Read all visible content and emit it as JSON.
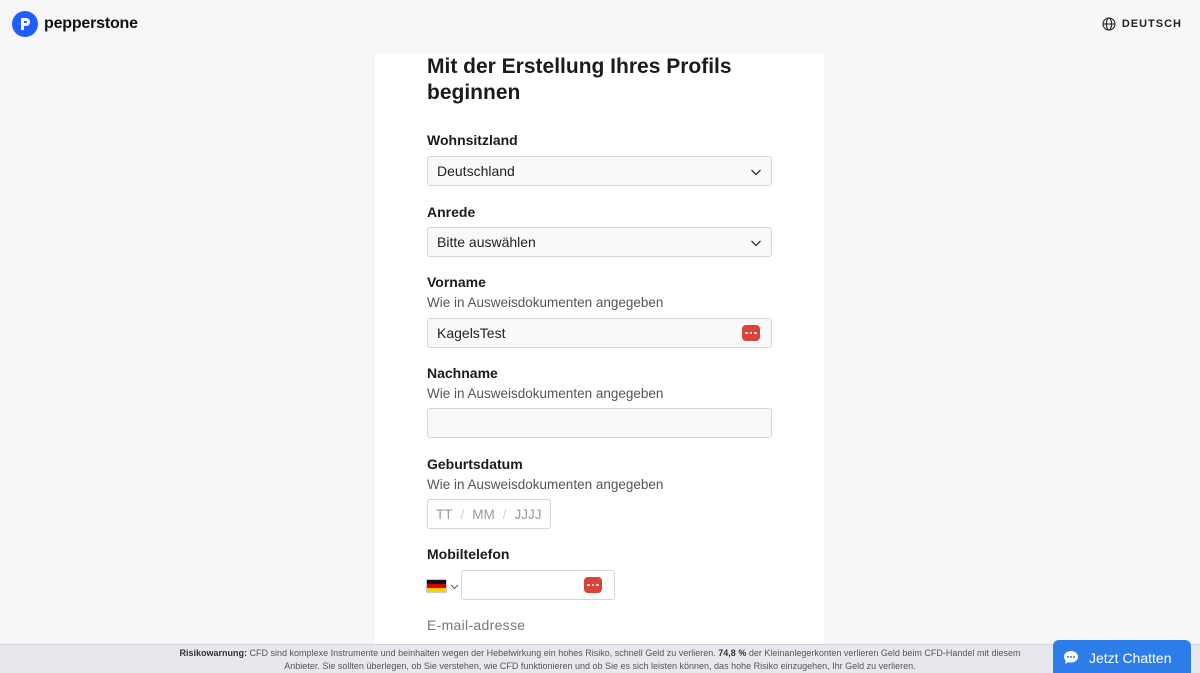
{
  "brand": {
    "name": "pepperstone",
    "color": "#1f5fff"
  },
  "header": {
    "language": "DEUTSCH"
  },
  "form": {
    "title": "Mit der Erstellung Ihres Profils beginnen",
    "residence": {
      "label": "Wohnsitzland",
      "value": "Deutschland"
    },
    "salutation": {
      "label": "Anrede",
      "value": "Bitte auswählen"
    },
    "firstname": {
      "label": "Vorname",
      "hint": "Wie in Ausweisdokumenten angegeben",
      "value": "KagelsTest"
    },
    "lastname": {
      "label": "Nachname",
      "hint": "Wie in Ausweisdokumenten angegeben",
      "value": ""
    },
    "birthdate": {
      "label": "Geburtsdatum",
      "hint": "Wie in Ausweisdokumenten angegeben",
      "day": "TT",
      "month": "MM",
      "year": "JJJJ",
      "separator": "/"
    },
    "mobile": {
      "label": "Mobiltelefon",
      "country_flag": "de-flag-icon",
      "value": ""
    },
    "email": {
      "label": "E-mail-adresse"
    }
  },
  "risk_warning": {
    "prefix": "Risikowarnung:",
    "text1": " CFD sind komplexe Instrumente und beinhalten wegen der Hebelwirkung ein hohes Risiko, schnell Geld zu verlieren. ",
    "percent": "74,8 %",
    "text2": " der Kleinanlegerkonten verlieren Geld beim CFD-Handel mit diesem",
    "line2": "Anbieter. Sie sollten überlegen, ob Sie verstehen, wie CFD funktionieren und ob Sie es sich leisten können, das hohe Risiko einzugehen, Ihr Geld zu verlieren."
  },
  "chat": {
    "label": "Jetzt Chatten",
    "color": "#2d7de8"
  },
  "icons": {
    "password_manager": "password-manager-icon",
    "globe": "globe-icon",
    "chevron": "chevron-down-icon",
    "chat": "chat-bubble-icon"
  },
  "colors": {
    "password_icon": "#d9433b",
    "background": "#f7f7f7"
  }
}
